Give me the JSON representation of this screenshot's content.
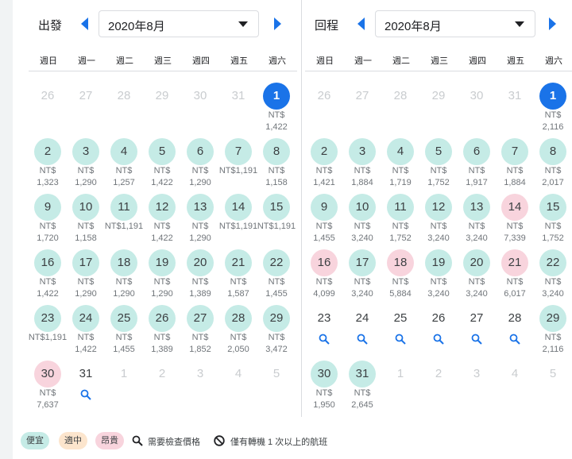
{
  "departure": {
    "label": "出發",
    "month_value": "2020年8月",
    "weekdays": [
      "週日",
      "週一",
      "週二",
      "週三",
      "週四",
      "週五",
      "週六"
    ],
    "days": [
      {
        "d": "26",
        "out": true
      },
      {
        "d": "27",
        "out": true
      },
      {
        "d": "28",
        "out": true
      },
      {
        "d": "29",
        "out": true
      },
      {
        "d": "30",
        "out": true
      },
      {
        "d": "31",
        "out": true
      },
      {
        "d": "1",
        "s": "selected",
        "p1": "NT$",
        "p2": "1,422"
      },
      {
        "d": "2",
        "s": "cheap",
        "p1": "NT$",
        "p2": "1,323"
      },
      {
        "d": "3",
        "s": "cheap",
        "p1": "NT$",
        "p2": "1,290"
      },
      {
        "d": "4",
        "s": "cheap",
        "p1": "NT$",
        "p2": "1,257"
      },
      {
        "d": "5",
        "s": "cheap",
        "p1": "NT$",
        "p2": "1,422"
      },
      {
        "d": "6",
        "s": "cheap",
        "p1": "NT$",
        "p2": "1,290"
      },
      {
        "d": "7",
        "s": "cheap",
        "p1": "NT$1,191"
      },
      {
        "d": "8",
        "s": "cheap",
        "p1": "NT$",
        "p2": "1,158"
      },
      {
        "d": "9",
        "s": "cheap",
        "p1": "NT$",
        "p2": "1,720"
      },
      {
        "d": "10",
        "s": "cheap",
        "p1": "NT$",
        "p2": "1,158"
      },
      {
        "d": "11",
        "s": "cheap",
        "p1": "NT$1,191"
      },
      {
        "d": "12",
        "s": "cheap",
        "p1": "NT$",
        "p2": "1,422"
      },
      {
        "d": "13",
        "s": "cheap",
        "p1": "NT$",
        "p2": "1,290"
      },
      {
        "d": "14",
        "s": "cheap",
        "p1": "NT$1,191"
      },
      {
        "d": "15",
        "s": "cheap",
        "p1": "NT$1,191"
      },
      {
        "d": "16",
        "s": "cheap",
        "p1": "NT$",
        "p2": "1,422"
      },
      {
        "d": "17",
        "s": "cheap",
        "p1": "NT$",
        "p2": "1,290"
      },
      {
        "d": "18",
        "s": "cheap",
        "p1": "NT$",
        "p2": "1,290"
      },
      {
        "d": "19",
        "s": "cheap",
        "p1": "NT$",
        "p2": "1,290"
      },
      {
        "d": "20",
        "s": "cheap",
        "p1": "NT$",
        "p2": "1,389"
      },
      {
        "d": "21",
        "s": "cheap",
        "p1": "NT$",
        "p2": "1,587"
      },
      {
        "d": "22",
        "s": "cheap",
        "p1": "NT$",
        "p2": "1,455"
      },
      {
        "d": "23",
        "s": "cheap",
        "p1": "NT$1,191"
      },
      {
        "d": "24",
        "s": "cheap",
        "p1": "NT$",
        "p2": "1,422"
      },
      {
        "d": "25",
        "s": "cheap",
        "p1": "NT$",
        "p2": "1,455"
      },
      {
        "d": "26",
        "s": "cheap",
        "p1": "NT$",
        "p2": "1,389"
      },
      {
        "d": "27",
        "s": "cheap",
        "p1": "NT$",
        "p2": "1,852"
      },
      {
        "d": "28",
        "s": "cheap",
        "p1": "NT$",
        "p2": "2,050"
      },
      {
        "d": "29",
        "s": "cheap",
        "p1": "NT$",
        "p2": "3,472"
      },
      {
        "d": "30",
        "s": "expensive",
        "p1": "NT$",
        "p2": "7,637"
      },
      {
        "d": "31",
        "s": "none",
        "search": true
      },
      {
        "d": "1",
        "out": true
      },
      {
        "d": "2",
        "out": true
      },
      {
        "d": "3",
        "out": true
      },
      {
        "d": "4",
        "out": true
      },
      {
        "d": "5",
        "out": true
      }
    ]
  },
  "return": {
    "label": "回程",
    "month_value": "2020年8月",
    "weekdays": [
      "週日",
      "週一",
      "週二",
      "週三",
      "週四",
      "週五",
      "週六"
    ],
    "days": [
      {
        "d": "26",
        "out": true
      },
      {
        "d": "27",
        "out": true
      },
      {
        "d": "28",
        "out": true
      },
      {
        "d": "29",
        "out": true
      },
      {
        "d": "30",
        "out": true
      },
      {
        "d": "31",
        "out": true
      },
      {
        "d": "1",
        "s": "selected",
        "p1": "NT$",
        "p2": "2,116"
      },
      {
        "d": "2",
        "s": "cheap",
        "p1": "NT$",
        "p2": "1,421"
      },
      {
        "d": "3",
        "s": "cheap",
        "p1": "NT$",
        "p2": "1,884"
      },
      {
        "d": "4",
        "s": "cheap",
        "p1": "NT$",
        "p2": "1,719"
      },
      {
        "d": "5",
        "s": "cheap",
        "p1": "NT$",
        "p2": "1,752"
      },
      {
        "d": "6",
        "s": "cheap",
        "p1": "NT$",
        "p2": "1,917"
      },
      {
        "d": "7",
        "s": "cheap",
        "p1": "NT$",
        "p2": "1,884"
      },
      {
        "d": "8",
        "s": "cheap",
        "p1": "NT$",
        "p2": "2,017"
      },
      {
        "d": "9",
        "s": "cheap",
        "p1": "NT$",
        "p2": "1,455"
      },
      {
        "d": "10",
        "s": "cheap",
        "p1": "NT$",
        "p2": "3,240"
      },
      {
        "d": "11",
        "s": "cheap",
        "p1": "NT$",
        "p2": "1,752"
      },
      {
        "d": "12",
        "s": "cheap",
        "p1": "NT$",
        "p2": "3,240"
      },
      {
        "d": "13",
        "s": "cheap",
        "p1": "NT$",
        "p2": "3,240"
      },
      {
        "d": "14",
        "s": "expensive",
        "p1": "NT$",
        "p2": "7,339"
      },
      {
        "d": "15",
        "s": "cheap",
        "p1": "NT$",
        "p2": "1,752"
      },
      {
        "d": "16",
        "s": "expensive",
        "p1": "NT$",
        "p2": "4,099"
      },
      {
        "d": "17",
        "s": "cheap",
        "p1": "NT$",
        "p2": "3,240"
      },
      {
        "d": "18",
        "s": "expensive",
        "p1": "NT$",
        "p2": "5,884"
      },
      {
        "d": "19",
        "s": "cheap",
        "p1": "NT$",
        "p2": "3,240"
      },
      {
        "d": "20",
        "s": "cheap",
        "p1": "NT$",
        "p2": "3,240"
      },
      {
        "d": "21",
        "s": "expensive",
        "p1": "NT$",
        "p2": "6,017"
      },
      {
        "d": "22",
        "s": "cheap",
        "p1": "NT$",
        "p2": "3,240"
      },
      {
        "d": "23",
        "s": "none",
        "search": true
      },
      {
        "d": "24",
        "s": "none",
        "search": true
      },
      {
        "d": "25",
        "s": "none",
        "search": true
      },
      {
        "d": "26",
        "s": "none",
        "search": true
      },
      {
        "d": "27",
        "s": "none",
        "search": true
      },
      {
        "d": "28",
        "s": "none",
        "search": true
      },
      {
        "d": "29",
        "s": "cheap",
        "p1": "NT$",
        "p2": "2,116"
      },
      {
        "d": "30",
        "s": "cheap",
        "p1": "NT$",
        "p2": "1,950"
      },
      {
        "d": "31",
        "s": "cheap",
        "p1": "NT$",
        "p2": "2,645"
      },
      {
        "d": "1",
        "out": true
      },
      {
        "d": "2",
        "out": true
      },
      {
        "d": "3",
        "out": true
      },
      {
        "d": "4",
        "out": true
      },
      {
        "d": "5",
        "out": true
      }
    ]
  },
  "legend": {
    "cheap": "便宜",
    "mid": "適中",
    "expensive": "昂貴",
    "check_price": "需要檢查價格",
    "connections": "僅有轉機 1 次以上的航班"
  },
  "colors": {
    "cheap": "#c5ebe6",
    "mid": "#fce5cd",
    "expensive": "#f8d4dd",
    "selected": "#1a73e8",
    "arrow": "#1a73e8",
    "search_icon": "#1a73e8"
  },
  "icons": {
    "prev": "chevron-left-icon",
    "next": "chevron-right-icon",
    "dropdown": "caret-down-icon",
    "search": "search-icon",
    "no_entry": "no-entry-icon"
  }
}
